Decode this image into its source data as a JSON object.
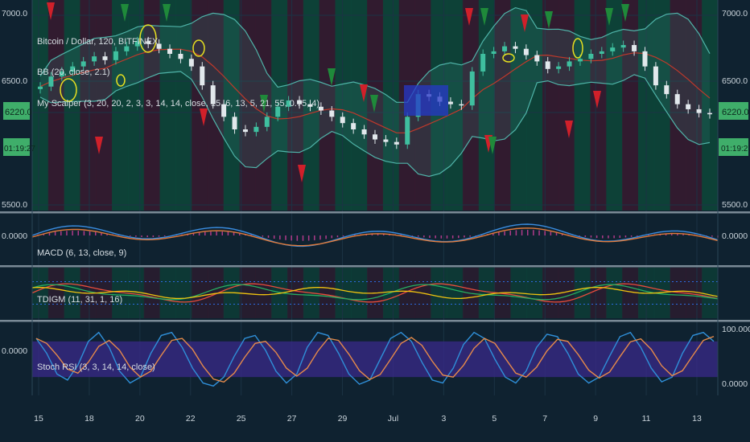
{
  "colors": {
    "background": "#0f2230",
    "grid": "#1b3344",
    "separator": "#7a8a96",
    "axis_text": "#c9d3da",
    "zone_green": "#0c4a3a",
    "zone_red": "#3a1a30",
    "bb_fill": "#3f8f86",
    "bb_line": "#4fb3a8",
    "bb_basis": "#c0392b",
    "candle_up": "#3fbf9f",
    "candle_down": "#e2e8ec",
    "macd": "#3a8de0",
    "signal": "#e07a3a",
    "hist": "#b03a8a",
    "tdi_green": "#27ae60",
    "tdi_red": "#e74c3c",
    "tdi_yellow": "#f1c40f",
    "tdi_blue": "#2d6be0",
    "stoch_k": "#2f8fd8",
    "stoch_d": "#e68a4a",
    "stoch_band": "#3a2a8a",
    "arrow_up": "#1f8a3a",
    "arrow_down": "#d0202a",
    "price_badge": "#3fae6a",
    "circle": "#e6e020",
    "box": "#2638c8"
  },
  "legend": {
    "main": "Bitcoin / Dollar, 120, BITFINEX",
    "bb": "BB (20, close, 2.1)",
    "scalper": "My Scalper (3, 20, 20, 2, 3, 3, 14, 14, close, 15, 6, 13, 5, 21, 55, 0.75, 4)",
    "macd": "MACD (6, 13, close, 9)",
    "tdi": "TDIGM (11, 31, 1, 16)",
    "stoch": "Stoch RSI (3, 3, 14, 14, close)"
  },
  "badges": {
    "price": "6220.0",
    "countdown": "01:19:27"
  },
  "chart_data": [
    {
      "type": "candlestick",
      "panel": "price",
      "y_ticks": [
        "7000.0",
        "6500.0",
        "6220.0",
        "5500.0"
      ],
      "approx_range": [
        5500,
        7000
      ],
      "overlays": [
        "Bollinger Bands",
        "BB basis"
      ],
      "x_ticks": [
        "15",
        "18",
        "20",
        "22",
        "25",
        "27",
        "29",
        "Jul",
        "3",
        "5",
        "7",
        "9",
        "11",
        "13"
      ],
      "close_approx": [
        6440,
        6520,
        6560,
        6600,
        6640,
        6680,
        6650,
        6720,
        6760,
        6800,
        6780,
        6740,
        6700,
        6660,
        6600,
        6450,
        6300,
        6200,
        6100,
        6080,
        6120,
        6200,
        6280,
        6330,
        6300,
        6280,
        6250,
        6200,
        6150,
        6100,
        6060,
        6020,
        6000,
        5980,
        6200,
        6380,
        6360,
        6320,
        6300,
        6290,
        6560,
        6700,
        6720,
        6760,
        6740,
        6690,
        6640,
        6580,
        6600,
        6640,
        6660,
        6700,
        6720,
        6750,
        6770,
        6720,
        6600,
        6450,
        6380,
        6300,
        6260,
        6230,
        6220
      ]
    },
    {
      "type": "line",
      "panel": "MACD",
      "y_ticks": [
        "0.0000"
      ],
      "series": [
        {
          "name": "MACD"
        },
        {
          "name": "Signal"
        },
        {
          "name": "Histogram"
        }
      ]
    },
    {
      "type": "line",
      "panel": "TDIGM",
      "series": [
        {
          "name": "TDI fast"
        },
        {
          "name": "TDI slow"
        },
        {
          "name": "Mid"
        },
        {
          "name": "Band"
        }
      ]
    },
    {
      "type": "line",
      "panel": "Stoch RSI",
      "y_ticks": [
        "100.0000",
        "0.0000"
      ],
      "ylim": [
        0,
        100
      ],
      "band": [
        20,
        80
      ],
      "k_approx": [
        85,
        60,
        25,
        15,
        40,
        80,
        95,
        70,
        30,
        10,
        20,
        60,
        90,
        95,
        70,
        35,
        10,
        5,
        20,
        55,
        85,
        90,
        65,
        30,
        10,
        25,
        70,
        95,
        90,
        60,
        25,
        8,
        15,
        50,
        85,
        95,
        80,
        45,
        15,
        10,
        35,
        75,
        95,
        85,
        50,
        20,
        10,
        30,
        70,
        92,
        88,
        60,
        25,
        10,
        20,
        55,
        88,
        95,
        70,
        35,
        12,
        20,
        60,
        90,
        95,
        80
      ]
    }
  ]
}
